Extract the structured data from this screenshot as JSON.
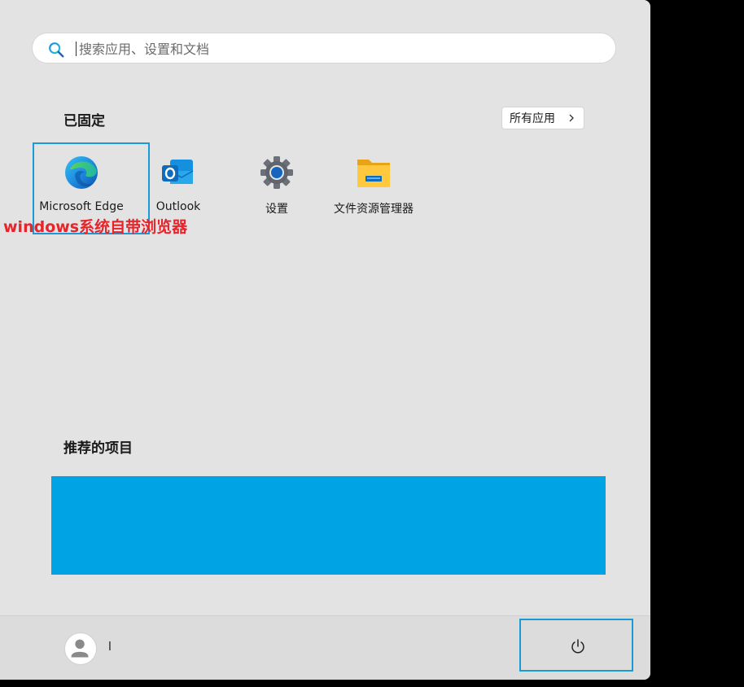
{
  "search": {
    "placeholder": "搜索应用、设置和文档",
    "icon": "search-icon"
  },
  "pinned": {
    "title": "已固定",
    "all_apps_label": "所有应用",
    "apps": [
      {
        "label": "Microsoft Edge",
        "icon": "edge-icon"
      },
      {
        "label": "Outlook",
        "icon": "outlook-icon"
      },
      {
        "label": "设置",
        "icon": "gear-icon"
      },
      {
        "label": "文件资源管理器",
        "icon": "folder-icon"
      }
    ]
  },
  "annotation": {
    "text": "windows系统自带浏览器",
    "color": "#e8232a"
  },
  "recommended": {
    "title": "推荐的项目",
    "block_color": "#00a4e4"
  },
  "footer": {
    "user_name": "l",
    "avatar_icon": "user-avatar-icon",
    "power_icon": "power-icon"
  },
  "colors": {
    "panel": "#e3e3e3",
    "highlight": "#1a9bd7"
  }
}
